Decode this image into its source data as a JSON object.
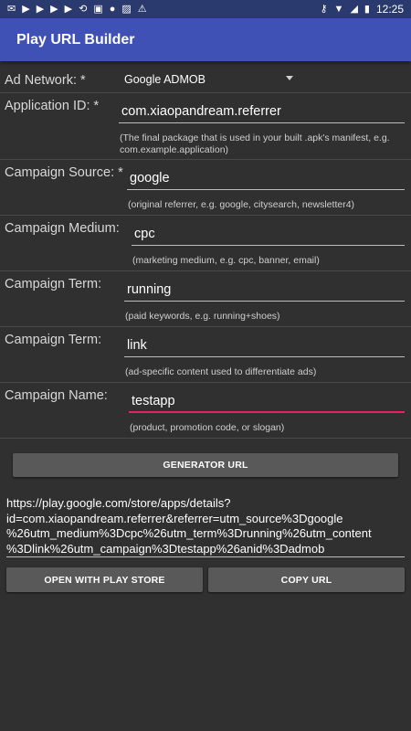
{
  "status_bar": {
    "time": "12:25",
    "left_icons": [
      "mail-icon",
      "play-icon",
      "play-icon",
      "play-icon",
      "play-icon",
      "no-rotate-icon",
      "screen-icon",
      "android-icon",
      "photo-icon",
      "warning-icon"
    ],
    "right_icons": [
      "key-icon",
      "wifi-icon",
      "signal-icon",
      "battery-icon"
    ]
  },
  "app_bar": {
    "title": "Play URL Builder"
  },
  "form": {
    "ad_network": {
      "label": "Ad Network: *",
      "value": "Google ADMOB"
    },
    "application_id": {
      "label": "Application ID: *",
      "value": "com.xiaopandream.referrer",
      "hint_line1": "(The final package that is used in your built .apk's manifest, e.g.",
      "hint_line2": "com.example.application)"
    },
    "campaign_source": {
      "label": "Campaign Source: *",
      "value": "google",
      "hint": "(original referrer, e.g. google, citysearch, newsletter4)"
    },
    "campaign_medium": {
      "label": "Campaign Medium:",
      "value": "cpc",
      "hint": "(marketing medium, e.g. cpc, banner, email)"
    },
    "campaign_term": {
      "label": "Campaign Term:",
      "value": "running",
      "hint": "(paid keywords, e.g. running+shoes)"
    },
    "campaign_content": {
      "label": "Campaign Term:",
      "value": "link",
      "hint": "(ad-specific content used to differentiate ads)"
    },
    "campaign_name": {
      "label": "Campaign Name:",
      "value": "testapp",
      "hint": "(product, promotion code, or slogan)"
    }
  },
  "actions": {
    "generate_label": "GENERATOR URL",
    "open_label": "OPEN WITH PLAY STORE",
    "copy_label": "COPY URL"
  },
  "result": {
    "line1": "https://play.google.com/store/apps/details?",
    "line2": "id=com.xiaopandream.referrer&referrer=utm_source%3Dgoogle",
    "line3": "%26utm_medium%3Dcpc%26utm_term%3Drunning%26utm_content",
    "line4": "%3Dlink%26utm_campaign%3Dtestapp%26anid%3Dadmob"
  },
  "colors": {
    "app_bar": "#3f51b5",
    "status_bar": "#2a3a6e",
    "background": "#303030",
    "focus_underline": "#e91e63",
    "button": "#595959"
  }
}
